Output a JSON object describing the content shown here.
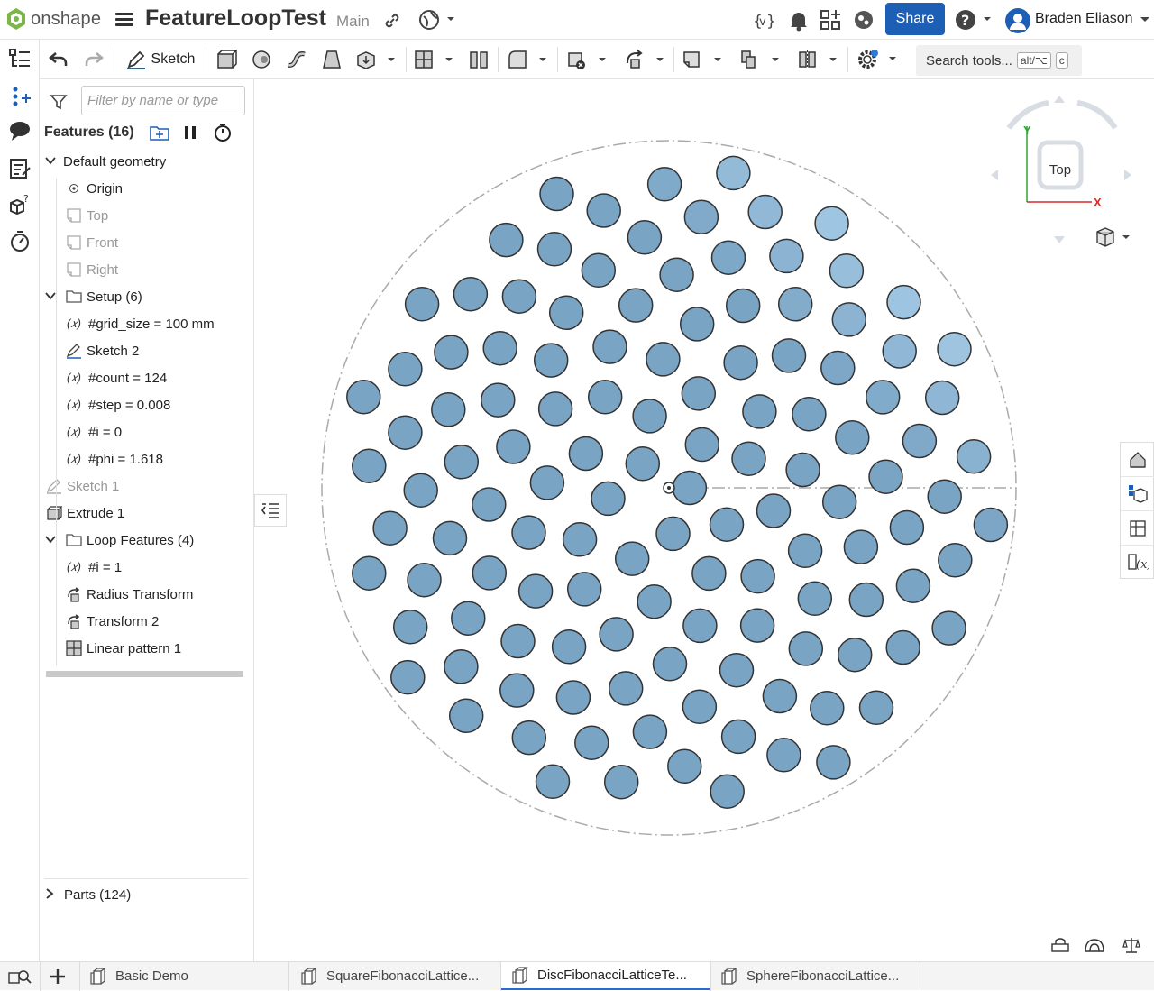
{
  "app": {
    "logo": "onshape",
    "title": "FeatureLoopTest",
    "branch": "Main"
  },
  "header": {
    "share_label": "Share",
    "user_name": "Braden Eliason"
  },
  "toolbar": {
    "sketch_label": "Sketch",
    "search_label": "Search tools...",
    "search_kbd1": "alt/⌥",
    "search_kbd2": "c"
  },
  "panel": {
    "filter_placeholder": "Filter by name or type",
    "features_title": "Features (16)",
    "default_geometry": "Default geometry",
    "origin": "Origin",
    "plane_top": "Top",
    "plane_front": "Front",
    "plane_right": "Right",
    "setup_folder": "Setup (6)",
    "var_grid_size": "#grid_size = 100 mm",
    "sketch2": "Sketch 2",
    "var_count": "#count = 124",
    "var_step": "#step = 0.008",
    "var_i0": "#i = 0",
    "var_phi": "#phi = 1.618",
    "sketch1": "Sketch 1",
    "extrude1": "Extrude 1",
    "loop_folder": "Loop Features (4)",
    "var_i1": "#i = 1",
    "radius_transform": "Radius Transform",
    "transform2": "Transform 2",
    "linear_pattern": "Linear pattern 1",
    "parts": "Parts (124)",
    "var_symbol": "(𝑥)"
  },
  "viewcube": {
    "face_label": "Top",
    "axis_y": "Y",
    "axis_x": "X"
  },
  "tabs": [
    {
      "label": "Basic Demo"
    },
    {
      "label": "SquareFibonacciLattice..."
    },
    {
      "label": "DiscFibonacciLatticeTe..."
    },
    {
      "label": "SphereFibonacciLattice..."
    }
  ],
  "colors": {
    "accent": "#1d5fb4",
    "disc_fill_dark": "#6f9ab9",
    "disc_fill_light": "#bfe3fb"
  }
}
